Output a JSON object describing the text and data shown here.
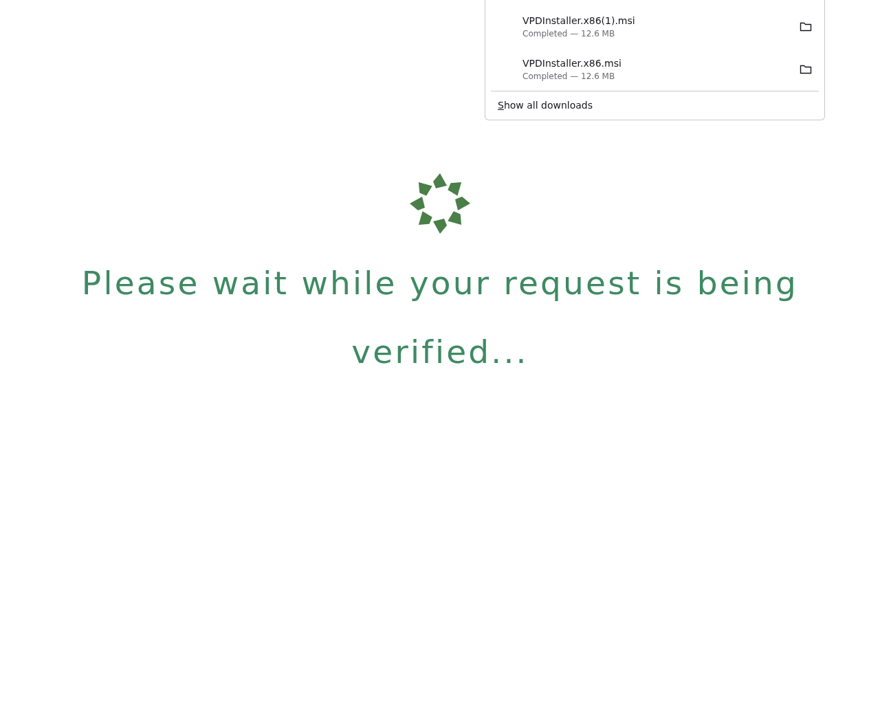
{
  "downloads_panel": {
    "items": [
      {
        "filename": "VPDInstaller.x86(1).msi",
        "status": "Completed — 12.6 MB"
      },
      {
        "filename": "VPDInstaller.x86.msi",
        "status": "Completed — 12.6 MB"
      }
    ],
    "show_all_link": "Show all downloads"
  },
  "message": "Please wait while your request is being verified..."
}
